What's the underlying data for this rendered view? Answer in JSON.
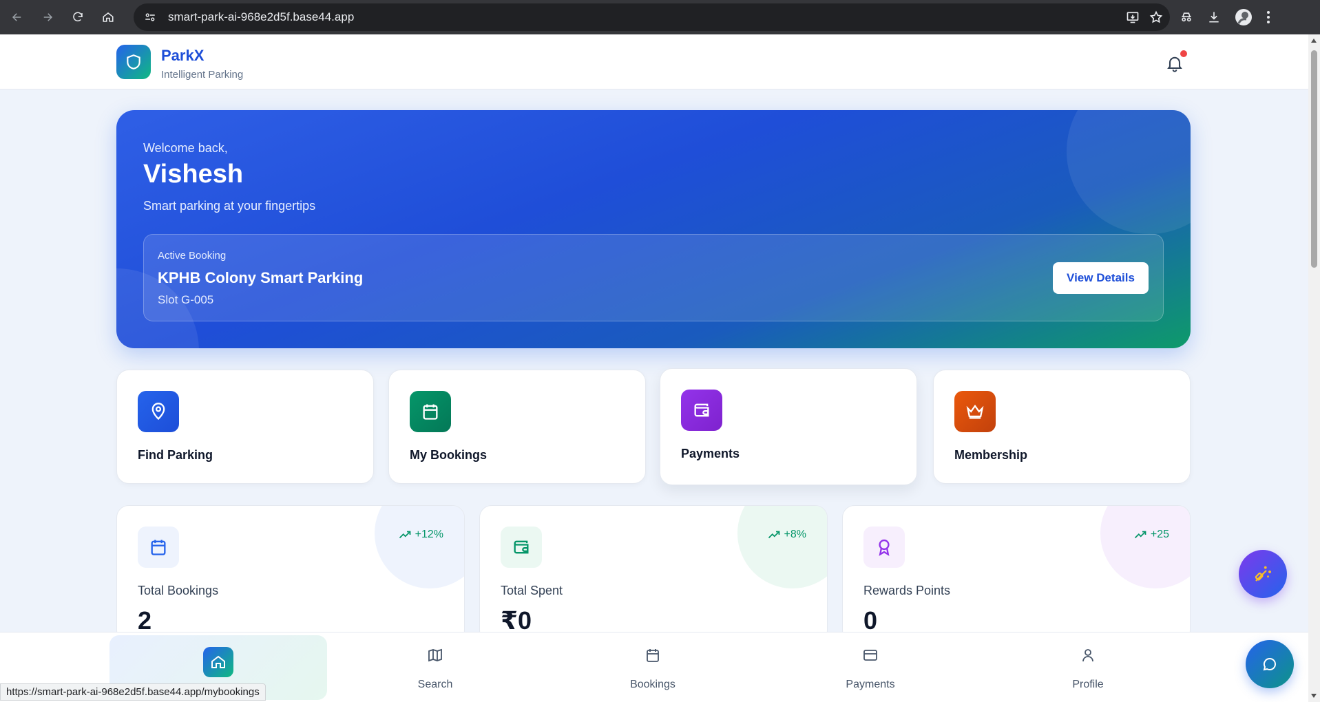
{
  "browser": {
    "url": "smart-park-ai-968e2d5f.base44.app",
    "status_url": "https://smart-park-ai-968e2d5f.base44.app/mybookings"
  },
  "header": {
    "brand": "ParkX",
    "tagline": "Intelligent Parking",
    "notification_dot": true
  },
  "hero": {
    "welcome": "Welcome back,",
    "user_name": "Vishesh",
    "subtitle": "Smart parking at your fingertips",
    "active_booking": {
      "label": "Active Booking",
      "location": "KPHB Colony Smart Parking",
      "slot": "Slot G-005",
      "button": "View Details"
    }
  },
  "quick_actions": [
    {
      "label": "Find Parking",
      "icon": "map-pin-icon",
      "color": "#2563eb"
    },
    {
      "label": "My Bookings",
      "icon": "calendar-icon",
      "color": "#059669"
    },
    {
      "label": "Payments",
      "icon": "wallet-icon",
      "color": "#9333ea"
    },
    {
      "label": "Membership",
      "icon": "crown-icon",
      "color": "#ea580c"
    }
  ],
  "stats": [
    {
      "label": "Total Bookings",
      "value": "2",
      "trend": "+12%",
      "icon": "calendar-icon",
      "color": "#2563eb"
    },
    {
      "label": "Total Spent",
      "value": "₹0",
      "trend": "+8%",
      "icon": "wallet-icon",
      "color": "#059669"
    },
    {
      "label": "Rewards Points",
      "value": "0",
      "trend": "+25",
      "icon": "award-icon",
      "color": "#9333ea"
    }
  ],
  "bottom_nav": [
    {
      "label": "Home",
      "icon": "home-icon",
      "active": true
    },
    {
      "label": "Search",
      "icon": "map-icon",
      "active": false
    },
    {
      "label": "Bookings",
      "icon": "calendar-icon",
      "active": false
    },
    {
      "label": "Payments",
      "icon": "credit-card-icon",
      "active": false
    },
    {
      "label": "Profile",
      "icon": "user-icon",
      "active": false
    }
  ]
}
